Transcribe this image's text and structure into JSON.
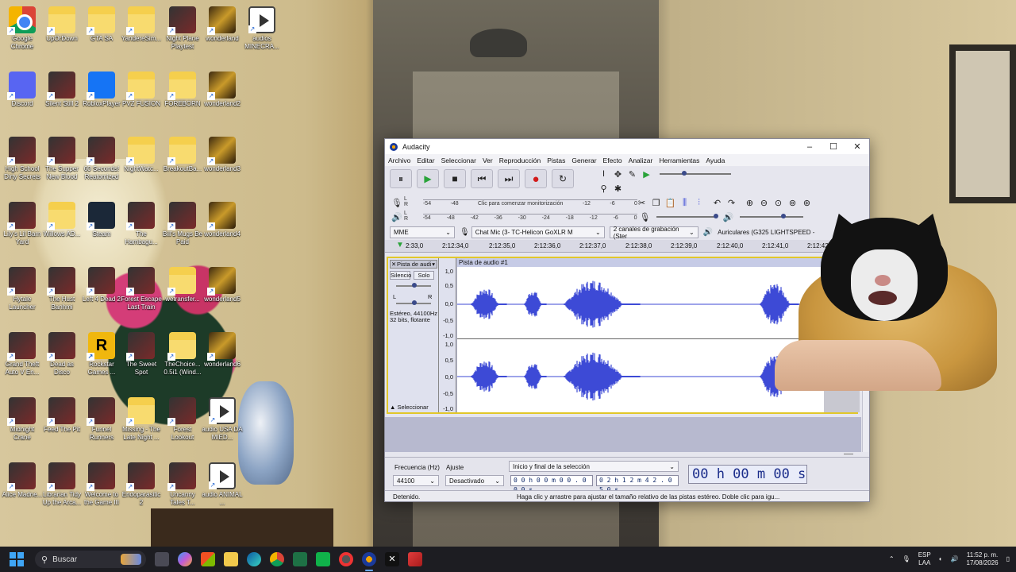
{
  "desktop": {
    "icons": [
      {
        "label": "Google Chrome",
        "icon": "chrome-icon"
      },
      {
        "label": "UpOrDown",
        "icon": "folder-icon"
      },
      {
        "label": "GTA SA",
        "icon": "folder-icon"
      },
      {
        "label": "YandereSim...",
        "icon": "folder-icon"
      },
      {
        "label": "Night Plane Playtest",
        "icon": "game-icon"
      },
      {
        "label": "wonderland",
        "icon": "wonderland-icon"
      },
      {
        "label": "audios MINECRA...",
        "icon": "media-icon"
      },
      {
        "label": "Discord",
        "icon": "discord-icon"
      },
      {
        "label": "Silent Still 2",
        "icon": "game-icon"
      },
      {
        "label": "RobloxPlayer",
        "icon": "roblox-icon"
      },
      {
        "label": "PVZ FUSION",
        "icon": "folder-icon"
      },
      {
        "label": "FOREBORN",
        "icon": "folder-icon"
      },
      {
        "label": "wonderland2",
        "icon": "wonderland-icon"
      },
      {
        "label": "High School Dirty Secrets",
        "icon": "game-icon"
      },
      {
        "label": "The Supper New Blood",
        "icon": "game-icon"
      },
      {
        "label": "60 Seconds! Reatomized",
        "icon": "game-icon"
      },
      {
        "label": "NightWatc...",
        "icon": "folder-icon"
      },
      {
        "label": "BreakoutBa...",
        "icon": "folder-icon"
      },
      {
        "label": "wonderland3",
        "icon": "wonderland-icon"
      },
      {
        "label": "Lily's Lil Barn Yard",
        "icon": "game-icon"
      },
      {
        "label": "Willows AD...",
        "icon": "folder-icon"
      },
      {
        "label": "Steam",
        "icon": "steam-icon"
      },
      {
        "label": "The Hambagu...",
        "icon": "game-icon"
      },
      {
        "label": "Bill's Mugs Be Paid",
        "icon": "game-icon"
      },
      {
        "label": "wonderland4",
        "icon": "wonderland-icon"
      },
      {
        "label": "Hytale Launcher",
        "icon": "game-icon"
      },
      {
        "label": "The Hust Banhmi",
        "icon": "game-icon"
      },
      {
        "label": "Left 4 Dead 2",
        "icon": "game-icon"
      },
      {
        "label": "Forest Escape Last Train",
        "icon": "game-icon"
      },
      {
        "label": "wetransfer...",
        "icon": "folder-icon"
      },
      {
        "label": "wonderland5",
        "icon": "wonderland-icon"
      },
      {
        "label": "Grand Theft Auto V En...",
        "icon": "game-icon"
      },
      {
        "label": "Dead as Disco",
        "icon": "game-icon"
      },
      {
        "label": "Rockstar Games ...",
        "icon": "rockstar-icon"
      },
      {
        "label": "The Sweet Spot",
        "icon": "game-icon"
      },
      {
        "label": "TheChoice... 0.5i1 (Wind...",
        "icon": "folder-icon"
      },
      {
        "label": "wonderland6",
        "icon": "wonderland-icon"
      },
      {
        "label": "Midnight Crane",
        "icon": "game-icon"
      },
      {
        "label": "Feed The Pit",
        "icon": "game-icon"
      },
      {
        "label": "Funnel Runners",
        "icon": "game-icon"
      },
      {
        "label": "Missing - The Late Night ...",
        "icon": "folder-icon"
      },
      {
        "label": "Forest Lookout",
        "icon": "game-icon"
      },
      {
        "label": "audio USA DA MIED...",
        "icon": "media-icon"
      },
      {
        "label": "Alice Madne...",
        "icon": "game-icon"
      },
      {
        "label": "Librarian Tidy Up the Arca...",
        "icon": "game-icon"
      },
      {
        "label": "Welcome to the Game III",
        "icon": "game-icon"
      },
      {
        "label": "Endoparasitic 2",
        "icon": "game-icon"
      },
      {
        "label": "Uncanny Tales T...",
        "icon": "game-icon"
      },
      {
        "label": "audio ANIMAL ...",
        "icon": "media-icon"
      }
    ]
  },
  "audacity": {
    "title": "Audacity",
    "menu": [
      "Archivo",
      "Editar",
      "Seleccionar",
      "Ver",
      "Reproducción",
      "Pistas",
      "Generar",
      "Efecto",
      "Analizar",
      "Herramientas",
      "Ayuda"
    ],
    "transport": {
      "pause": "⏸",
      "play": "▶",
      "stop": "■",
      "skip_start": "⏮",
      "skip_end": "⏭",
      "record": "●",
      "loop": "↻"
    },
    "meters": {
      "rec_prompt": "Clic para comenzar monitorización",
      "rec_scale": [
        "-54",
        "-48",
        "",
        "",
        "",
        "",
        "-12",
        "-6",
        "0"
      ],
      "play_scale": [
        "-54",
        "-48",
        "-42",
        "-36",
        "-30",
        "-24",
        "-18",
        "-12",
        "-6",
        "0"
      ],
      "lr_l": "L",
      "lr_r": "R"
    },
    "devices": {
      "host": "MME",
      "rec_device": "Chat Mic (3- TC-Helicon GoXLR M",
      "channels": "2 canales de grabación (Ster",
      "play_device": "Auriculares (G325 LIGHTSPEED -"
    },
    "ruler": [
      "2:33,0",
      "2:12:34,0",
      "2:12:35,0",
      "2:12:36,0",
      "2:12:37,0",
      "2:12:38,0",
      "2:12:39,0",
      "2:12:40,0",
      "2:12:41,0",
      "2:12:42"
    ],
    "track": {
      "name": "Pista de audi",
      "clip_name": "Pista de audio #1",
      "mute": "Silencio",
      "solo": "Solo",
      "pan_l": "L",
      "pan_r": "R",
      "info": "Estéreo, 44100Hz\n32 bits, flotante",
      "info_line1": "Estéreo, 44100Hz",
      "info_line2": "32 bits, flotante",
      "select": "Seleccionar",
      "scale_top": [
        "1,0",
        "0,5",
        "0,0",
        "-0,5",
        "-1,0"
      ],
      "scale_bottom": [
        "1,0",
        "0,5",
        "0,0",
        "-0,5",
        "-1,0"
      ]
    },
    "selection": {
      "rate_label": "Frecuencia (Hz)",
      "snap_label": "Ajuste",
      "rate_value": "44100",
      "snap_value": "Desactivado",
      "mode": "Inicio y final de la selección",
      "start_time": "0 0 h 0 0 m 0 0 . 0 0 0 s",
      "end_time": "0 2 h 1 2 m 4 2 . 0 5 0 s",
      "big_time": "00 h 00 m 00 s"
    },
    "status": {
      "state": "Detenido.",
      "hint": "Haga clic y arrastre para ajustar el tamaño relativo de las pistas estéreo. Doble clic para igu..."
    }
  },
  "taskbar": {
    "search_placeholder": "Buscar",
    "lang_top": "ESP",
    "lang_bottom": "LAA",
    "time": "11:52 p. m.",
    "date": "17/08/2026"
  },
  "colors": {
    "wave": "#3d4ad6",
    "selection_border": "#e1c72a",
    "taskbar": "#1d1d22"
  }
}
